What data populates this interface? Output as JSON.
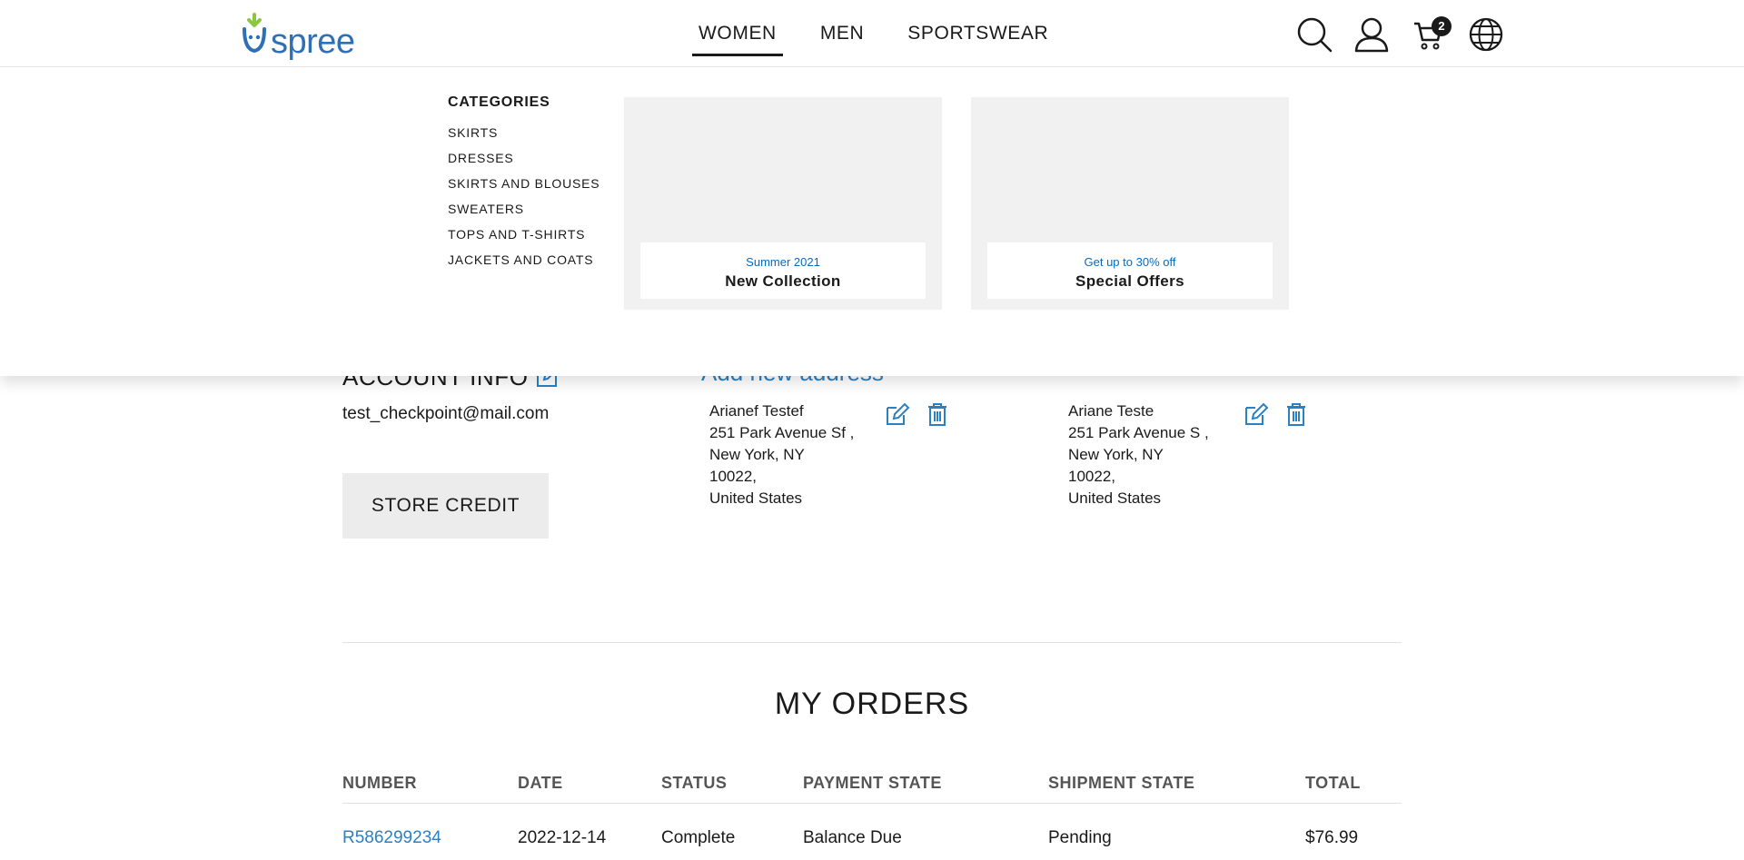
{
  "header": {
    "logo_text": "spree",
    "nav": [
      {
        "label": "WOMEN",
        "active": true
      },
      {
        "label": "MEN",
        "active": false
      },
      {
        "label": "SPORTSWEAR",
        "active": false
      }
    ],
    "icons": [
      "search-icon",
      "user-icon",
      "cart-icon",
      "globe-icon"
    ],
    "cart_count": "2"
  },
  "mega_menu": {
    "categories_title": "CATEGORIES",
    "categories": [
      "SKIRTS",
      "DRESSES",
      "SKIRTS AND BLOUSES",
      "SWEATERS",
      "TOPS AND T-SHIRTS",
      "JACKETS AND COATS"
    ],
    "promos": [
      {
        "subtitle": "Summer 2021",
        "title": "New Collection"
      },
      {
        "subtitle": "Get up to 30% off",
        "title": "Special Offers"
      }
    ]
  },
  "account": {
    "title": "ACCOUNT INFO",
    "email": "test_checkpoint@mail.com",
    "store_credit_label": "STORE CREDIT"
  },
  "addresses": {
    "add_label": "Add new address",
    "items": [
      {
        "name": "Arianef Testef",
        "street": "251 Park Avenue Sf ,",
        "city": "New York, NY",
        "zip": "10022,",
        "country": "United States"
      },
      {
        "name": "Ariane Teste",
        "street": "251 Park Avenue S ,",
        "city": "New York, NY",
        "zip": "10022,",
        "country": "United States"
      }
    ]
  },
  "orders": {
    "title": "MY ORDERS",
    "columns": [
      "NUMBER",
      "DATE",
      "STATUS",
      "PAYMENT STATE",
      "SHIPMENT STATE",
      "TOTAL"
    ],
    "rows": [
      {
        "number": "R586299234",
        "date": "2022-12-14",
        "status": "Complete",
        "payment_state": "Balance Due",
        "shipment_state": "Pending",
        "total": "$76.99"
      }
    ]
  },
  "colors": {
    "accent": "#2a80c5",
    "logo_green": "#8cc63f",
    "logo_blue": "#2f6fb5",
    "promo_bg": "#f1f1f1",
    "button_bg": "#ececec"
  }
}
